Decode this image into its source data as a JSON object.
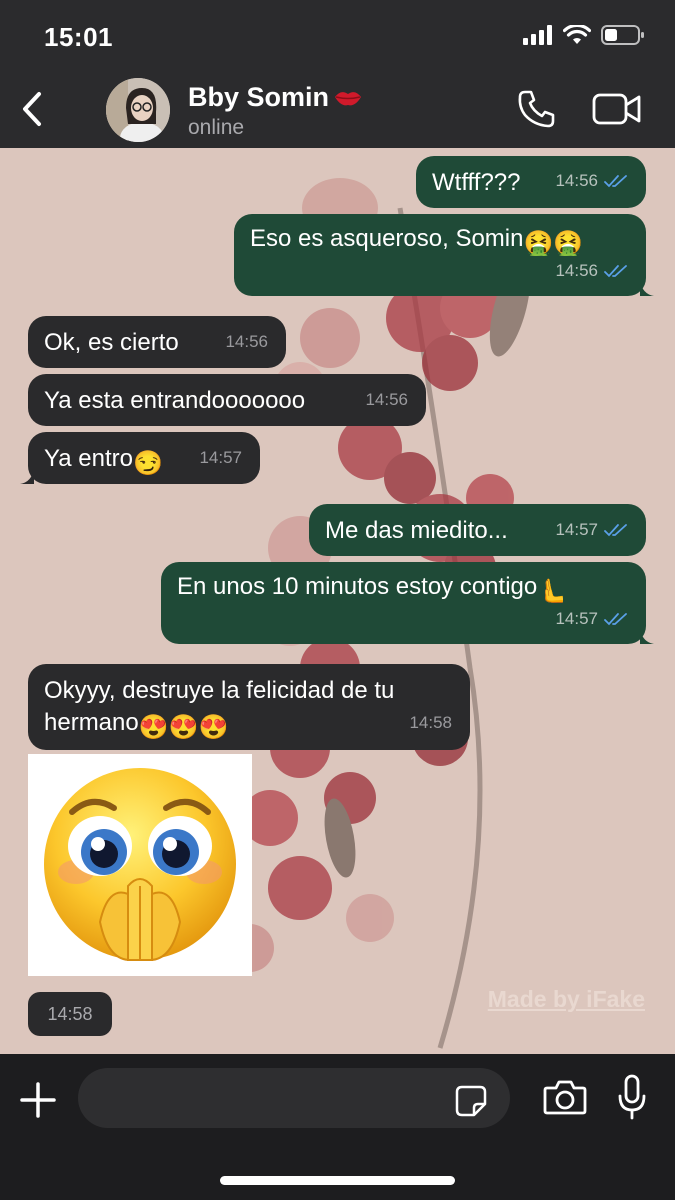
{
  "status_bar": {
    "time": "15:01"
  },
  "header": {
    "contact_name": "Bby Somin",
    "contact_status": "online"
  },
  "messages": [
    {
      "direction": "out",
      "text": "Wtfff???",
      "time": "14:56",
      "read": true
    },
    {
      "direction": "out",
      "text": "Eso es asqueroso, Somin",
      "emoji": "🤮🤮",
      "time": "14:56",
      "read": true
    },
    {
      "direction": "in",
      "text": "Ok, es cierto",
      "time": "14:56"
    },
    {
      "direction": "in",
      "text": "Ya esta entrandooooooo",
      "time": "14:56"
    },
    {
      "direction": "in",
      "text": "Ya entro",
      "emoji": "😏",
      "time": "14:57"
    },
    {
      "direction": "out",
      "text": "Me das miedito...",
      "time": "14:57",
      "read": true
    },
    {
      "direction": "out",
      "text": "En unos 10 minutos estoy contigo",
      "emoji": "🫷",
      "time": "14:57",
      "read": true
    },
    {
      "direction": "in",
      "text_line1": "Okyyy, destruye la felicidad de tu",
      "text_line2": "hermano",
      "emoji": "😍😍😍",
      "time": "14:58"
    },
    {
      "direction": "in",
      "type": "sticker",
      "sticker": "pleading-face-praying-hands",
      "time": "14:58"
    }
  ],
  "watermark": "Made by iFake",
  "input": {
    "placeholder": ""
  },
  "colors": {
    "header_bg": "#2b2b2d",
    "chat_bg": "#dcc6bd",
    "outgoing_bubble": "#1f4a37",
    "incoming_bubble": "#2a2a2c",
    "read_ticks": "#5aa0e8"
  }
}
